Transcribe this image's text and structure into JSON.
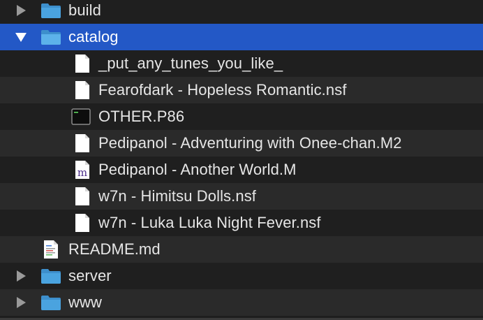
{
  "tree": {
    "items": [
      {
        "label": "build",
        "type": "folder",
        "expanded": false,
        "depth": 0
      },
      {
        "label": "catalog",
        "type": "folder",
        "expanded": true,
        "depth": 0,
        "selected": true
      },
      {
        "label": "_put_any_tunes_you_like_",
        "type": "file",
        "icon": "document-icon",
        "depth": 1
      },
      {
        "label": "Fearofdark - Hopeless Romantic.nsf",
        "type": "file",
        "icon": "document-icon",
        "depth": 1
      },
      {
        "label": "OTHER.P86",
        "type": "file",
        "icon": "terminal-icon",
        "depth": 1
      },
      {
        "label": "Pedipanol - Adventuring with Onee-chan.M2",
        "type": "file",
        "icon": "document-icon",
        "depth": 1
      },
      {
        "label": "Pedipanol - Another World.M",
        "type": "file",
        "icon": "m-file-icon",
        "depth": 1
      },
      {
        "label": "w7n - Himitsu Dolls.nsf",
        "type": "file",
        "icon": "document-icon",
        "depth": 1
      },
      {
        "label": "w7n - Luka Luka Night Fever.nsf",
        "type": "file",
        "icon": "document-icon",
        "depth": 1
      },
      {
        "label": "README.md",
        "type": "file",
        "icon": "text-document-icon",
        "depth": 0
      },
      {
        "label": "server",
        "type": "folder",
        "expanded": false,
        "depth": 0
      },
      {
        "label": "www",
        "type": "folder",
        "expanded": false,
        "depth": 0
      }
    ]
  },
  "colors": {
    "selection": "#2358c6",
    "folder": "#4aa3df",
    "row_odd": "#2a2a2a",
    "row_even": "#1f1f1f"
  }
}
